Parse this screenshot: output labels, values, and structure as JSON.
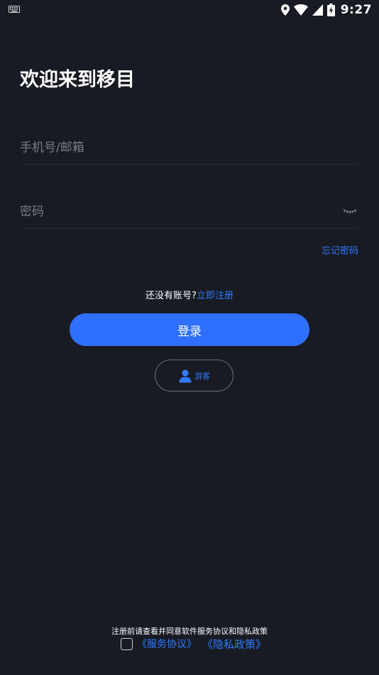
{
  "status_bar": {
    "time": "9:27",
    "icons": [
      "keyboard-icon",
      "location-icon",
      "wifi-icon",
      "signal-icon",
      "battery-charging-icon"
    ]
  },
  "title": "欢迎来到移目",
  "form": {
    "phone_placeholder": "手机号/邮箱",
    "phone_value": "",
    "password_placeholder": "密码",
    "password_value": "",
    "forgot_password": "忘记密码"
  },
  "register": {
    "question": "还没有账号?",
    "link": "立即注册"
  },
  "login_button": "登录",
  "guest_button": "游客",
  "agreement": {
    "text": "注册前请查看并同意软件服务协议和隐私政策",
    "service_link": "《服务协议》",
    "privacy_link": "《隐私政策》",
    "checked": false
  },
  "colors": {
    "background": "#181b23",
    "accent": "#2f6ffd",
    "link": "#2f7bff",
    "placeholder": "#7a7d85",
    "divider": "#262a33"
  }
}
